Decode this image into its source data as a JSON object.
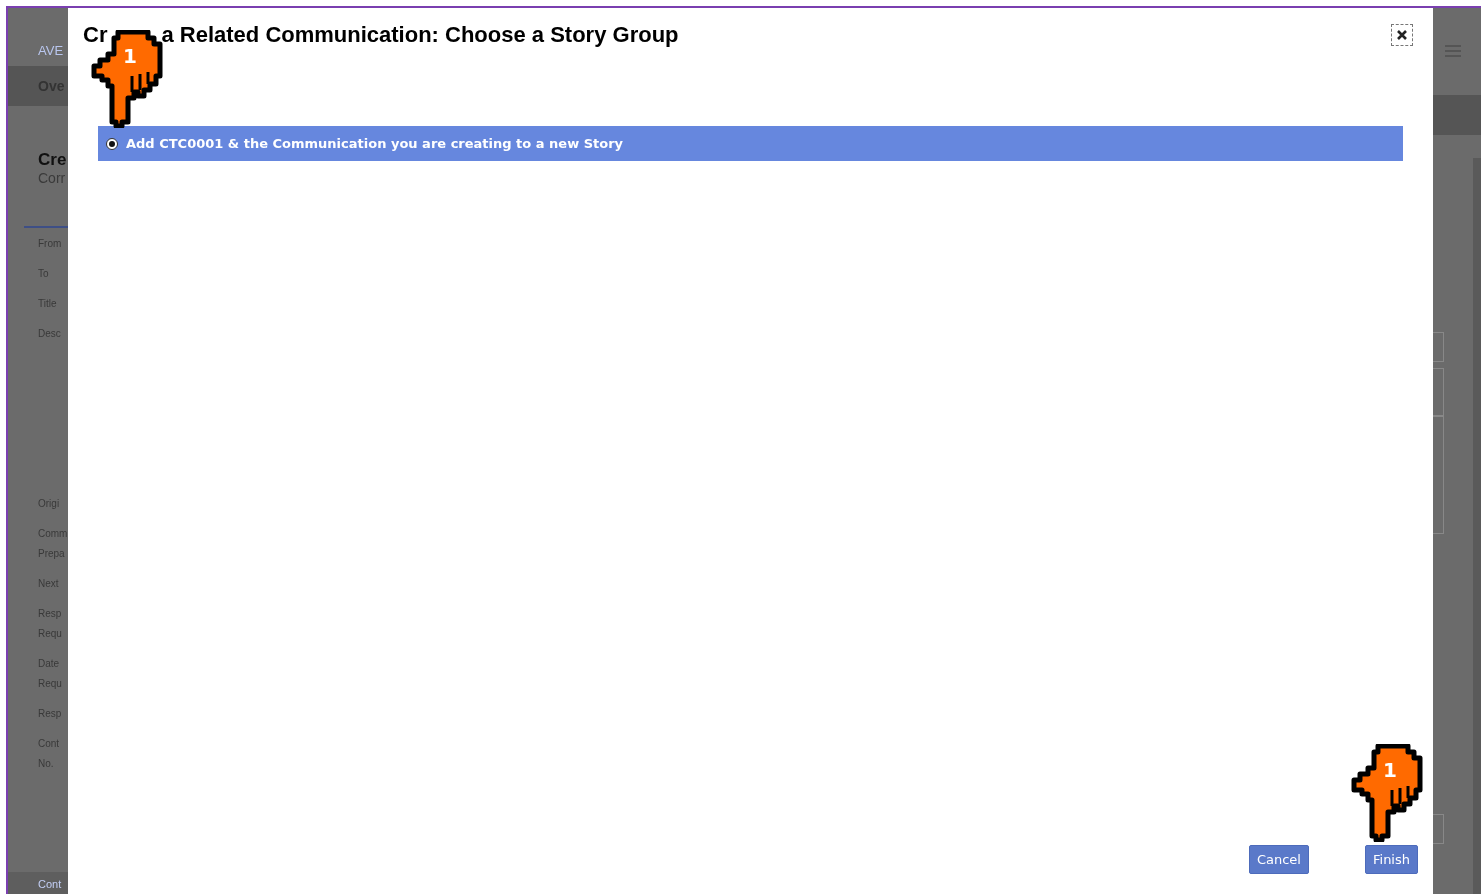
{
  "background_page": {
    "logo": "AVE",
    "tab": "Ove",
    "heading": "Cre",
    "subheading": "Corr",
    "field_labels": [
      {
        "lines": [
          "From"
        ]
      },
      {
        "lines": [
          "To"
        ]
      },
      {
        "lines": [
          "Title"
        ]
      },
      {
        "lines": [
          "Desc"
        ]
      },
      {
        "lines": [
          "Origi"
        ]
      },
      {
        "lines": [
          "Comm",
          "Prepa"
        ]
      },
      {
        "lines": [
          "Next"
        ]
      },
      {
        "lines": [
          "Resp",
          "Requ"
        ]
      },
      {
        "lines": [
          "Date",
          "Requ"
        ]
      },
      {
        "lines": [
          "Resp"
        ]
      },
      {
        "lines": [
          "Cont",
          "No."
        ]
      }
    ],
    "footer_link": "Cont"
  },
  "dialog": {
    "title_parts": [
      "Cr",
      "a Related Communication: Choose a Story Group"
    ],
    "options": [
      {
        "label": "Add CTC0001 & the Communication you are creating to a new Story",
        "selected": true
      }
    ],
    "buttons": [
      {
        "label": "Cancel"
      },
      {
        "label": "Finish"
      }
    ]
  },
  "step_markers": [
    {
      "label": "1"
    },
    {
      "label": "1"
    }
  ]
}
